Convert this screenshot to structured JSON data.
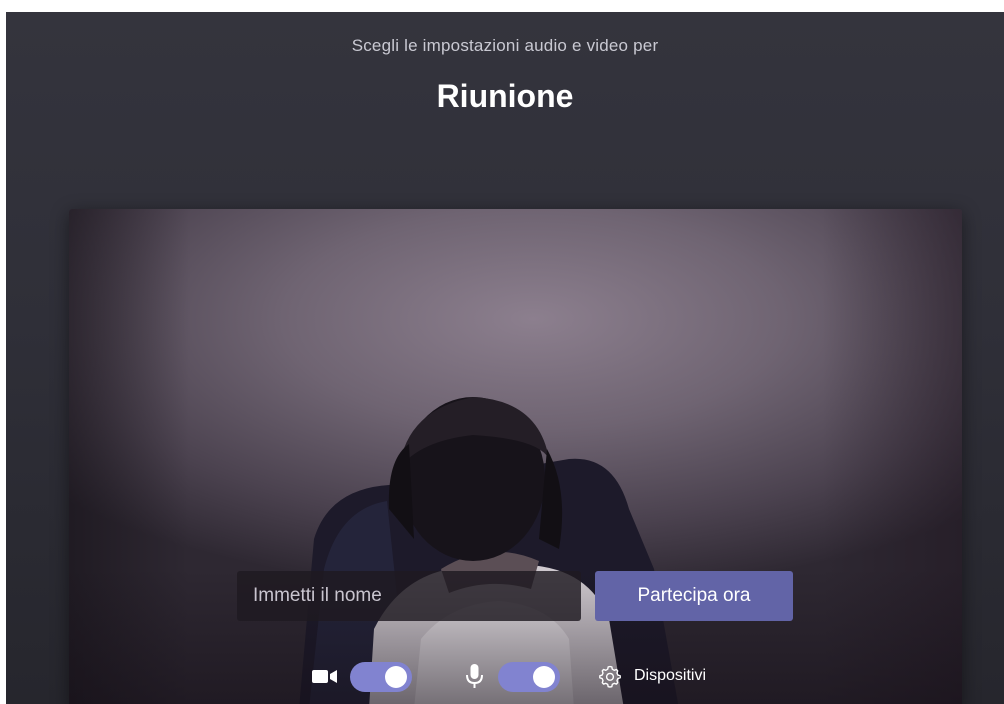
{
  "header": {
    "subtitle": "Scegli le impostazioni audio e video per",
    "title": "Riunione"
  },
  "join": {
    "name_placeholder": "Immetti il nome",
    "name_value": "",
    "join_label": "Partecipa ora"
  },
  "controls": {
    "camera": {
      "icon": "video-camera-icon",
      "enabled": true
    },
    "microphone": {
      "icon": "microphone-icon",
      "enabled": true
    },
    "devices": {
      "icon": "gear-icon",
      "label": "Dispositivi"
    }
  },
  "colors": {
    "accent": "#6264a7",
    "toggle_on": "#8183d0",
    "background": "#2f2f38"
  }
}
